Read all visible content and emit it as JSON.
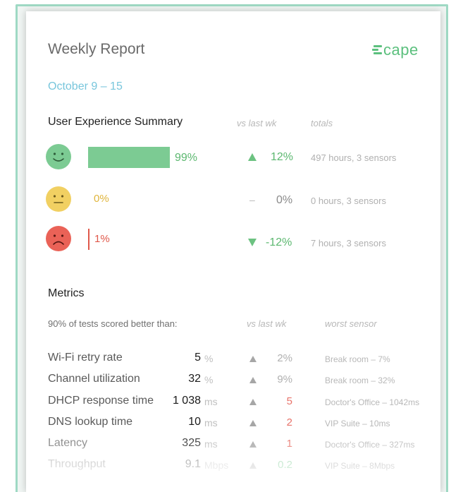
{
  "header": {
    "title": "Weekly Report",
    "logo_text": "cape",
    "logo_icon": "cape-logo-icon",
    "date_range": "October 9 – 15"
  },
  "ux_summary": {
    "title": "User Experience Summary",
    "col_vs": "vs last wk",
    "col_totals": "totals",
    "rows": [
      {
        "icon": "happy-face-icon",
        "color": "#5cb870",
        "share": 0.99,
        "pct": "99%",
        "change_dir": "up",
        "change": "12%",
        "totals": "497 hours, 3 sensors"
      },
      {
        "icon": "neutral-face-icon",
        "color": "#e0b53c",
        "share": 0.0,
        "pct": "0%",
        "change_dir": "none",
        "change_symbol": "–",
        "change": "0%",
        "totals": "0 hours, 3 sensors"
      },
      {
        "icon": "sad-face-icon",
        "color": "#e0584a",
        "share": 0.01,
        "pct": "1%",
        "change_dir": "down",
        "change": "-12%",
        "totals": "7 hours, 3 sensors"
      }
    ]
  },
  "metrics": {
    "title": "Metrics",
    "subtitle": "90% of tests scored better than:",
    "col_vs": "vs last wk",
    "col_worst": "worst sensor",
    "rows": [
      {
        "name": "Wi-Fi retry rate",
        "value": "5",
        "unit": "%",
        "change": "2%",
        "change_color": "#b0b0b0",
        "worst": "Break room – 7%"
      },
      {
        "name": "Channel utilization",
        "value": "32",
        "unit": "%",
        "change": "9%",
        "change_color": "#b0b0b0",
        "worst": "Break room – 32%"
      },
      {
        "name": "DHCP response time",
        "value": "1 038",
        "unit": "ms",
        "change": "5",
        "change_color": "#e8736a",
        "worst": "Doctor's Office – 1042ms"
      },
      {
        "name": "DNS lookup time",
        "value": "10",
        "unit": "ms",
        "change": "2",
        "change_color": "#e8736a",
        "worst": "VIP Suite – 10ms"
      },
      {
        "name": "Latency",
        "value": "325",
        "unit": "ms",
        "change": "1",
        "change_color": "#e8736a",
        "worst": "Doctor's Office – 327ms"
      },
      {
        "name": "Throughput",
        "value": "9.1",
        "unit": "Mbps",
        "change": "0.2",
        "change_color": "#9dd9ae",
        "worst": "VIP Suite – 8Mbps"
      }
    ]
  }
}
